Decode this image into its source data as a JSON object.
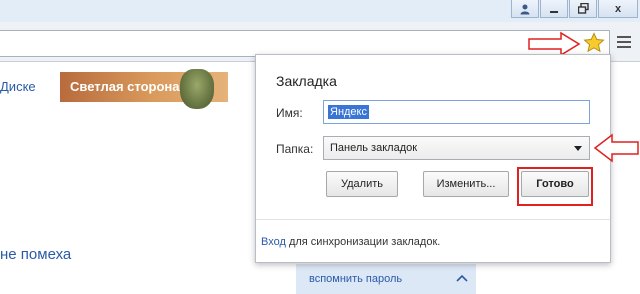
{
  "window": {
    "controls": {
      "user_icon": "user-icon",
      "minimize_icon": "minimize-icon",
      "restore_icon": "restore-icon",
      "close_label": "x"
    }
  },
  "toolbar": {
    "star_icon": "star-icon",
    "menu_icon": "menu-icon"
  },
  "page": {
    "disk_link": "Диске",
    "banner_text": "Светлая сторона",
    "helper_text": "не помеха",
    "remember_password": "вспомнить пароль"
  },
  "bookmark_popup": {
    "title": "Закладка",
    "name_label": "Имя:",
    "name_value": "Яндекс",
    "folder_label": "Папка:",
    "folder_value": "Панель закладок",
    "delete_button": "Удалить",
    "edit_button": "Изменить...",
    "done_button": "Готово",
    "sync_link": "Вход",
    "sync_text": " для синхронизации закладок."
  },
  "colors": {
    "annotation_red": "#e0211f",
    "link_blue": "#2a5aa8",
    "selection_blue": "#3875d7"
  }
}
